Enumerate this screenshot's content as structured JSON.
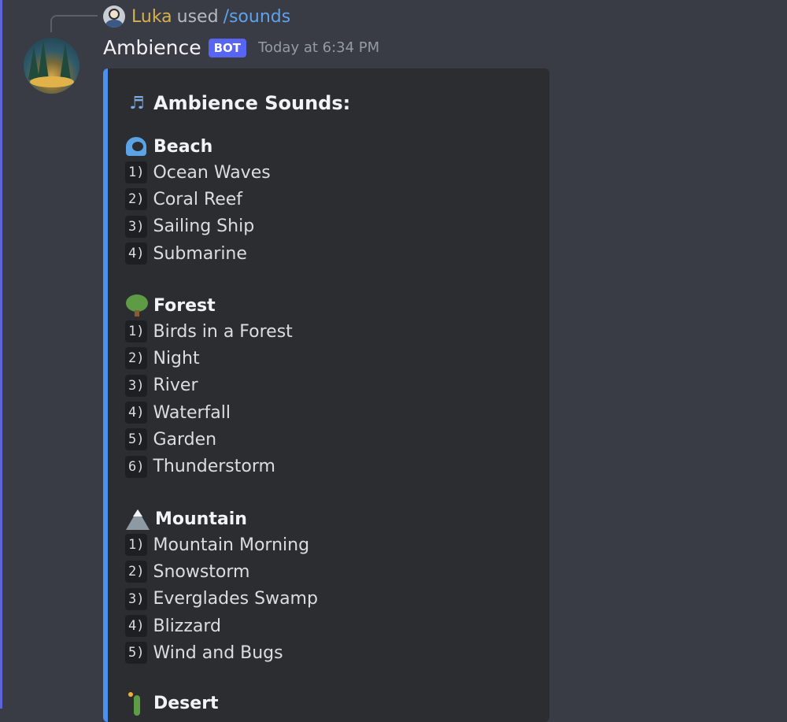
{
  "reply": {
    "user": "Luka",
    "action": "used",
    "command": "/sounds"
  },
  "message": {
    "author": "Ambience",
    "badge": "BOT",
    "timestamp": "Today at 6:34 PM"
  },
  "embed": {
    "title": "Ambience Sounds:",
    "title_icon": "musical-notes-icon",
    "accent_color": "#4c8fef",
    "sections": [
      {
        "name": "Beach",
        "icon": "wave-icon",
        "items": [
          {
            "num": "1)",
            "label": "Ocean Waves"
          },
          {
            "num": "2)",
            "label": "Coral Reef"
          },
          {
            "num": "3)",
            "label": "Sailing Ship"
          },
          {
            "num": "4)",
            "label": "Submarine"
          }
        ]
      },
      {
        "name": "Forest",
        "icon": "tree-icon",
        "items": [
          {
            "num": "1)",
            "label": "Birds in a Forest"
          },
          {
            "num": "2)",
            "label": "Night"
          },
          {
            "num": "3)",
            "label": "River"
          },
          {
            "num": "4)",
            "label": "Waterfall"
          },
          {
            "num": "5)",
            "label": "Garden"
          },
          {
            "num": "6)",
            "label": "Thunderstorm"
          }
        ]
      },
      {
        "name": "Mountain",
        "icon": "mountain-icon",
        "items": [
          {
            "num": "1)",
            "label": "Mountain Morning"
          },
          {
            "num": "2)",
            "label": "Snowstorm"
          },
          {
            "num": "3)",
            "label": "Everglades Swamp"
          },
          {
            "num": "4)",
            "label": "Blizzard"
          },
          {
            "num": "5)",
            "label": "Wind and Bugs"
          }
        ]
      },
      {
        "name": "Desert",
        "icon": "cactus-icon",
        "items": []
      }
    ]
  }
}
